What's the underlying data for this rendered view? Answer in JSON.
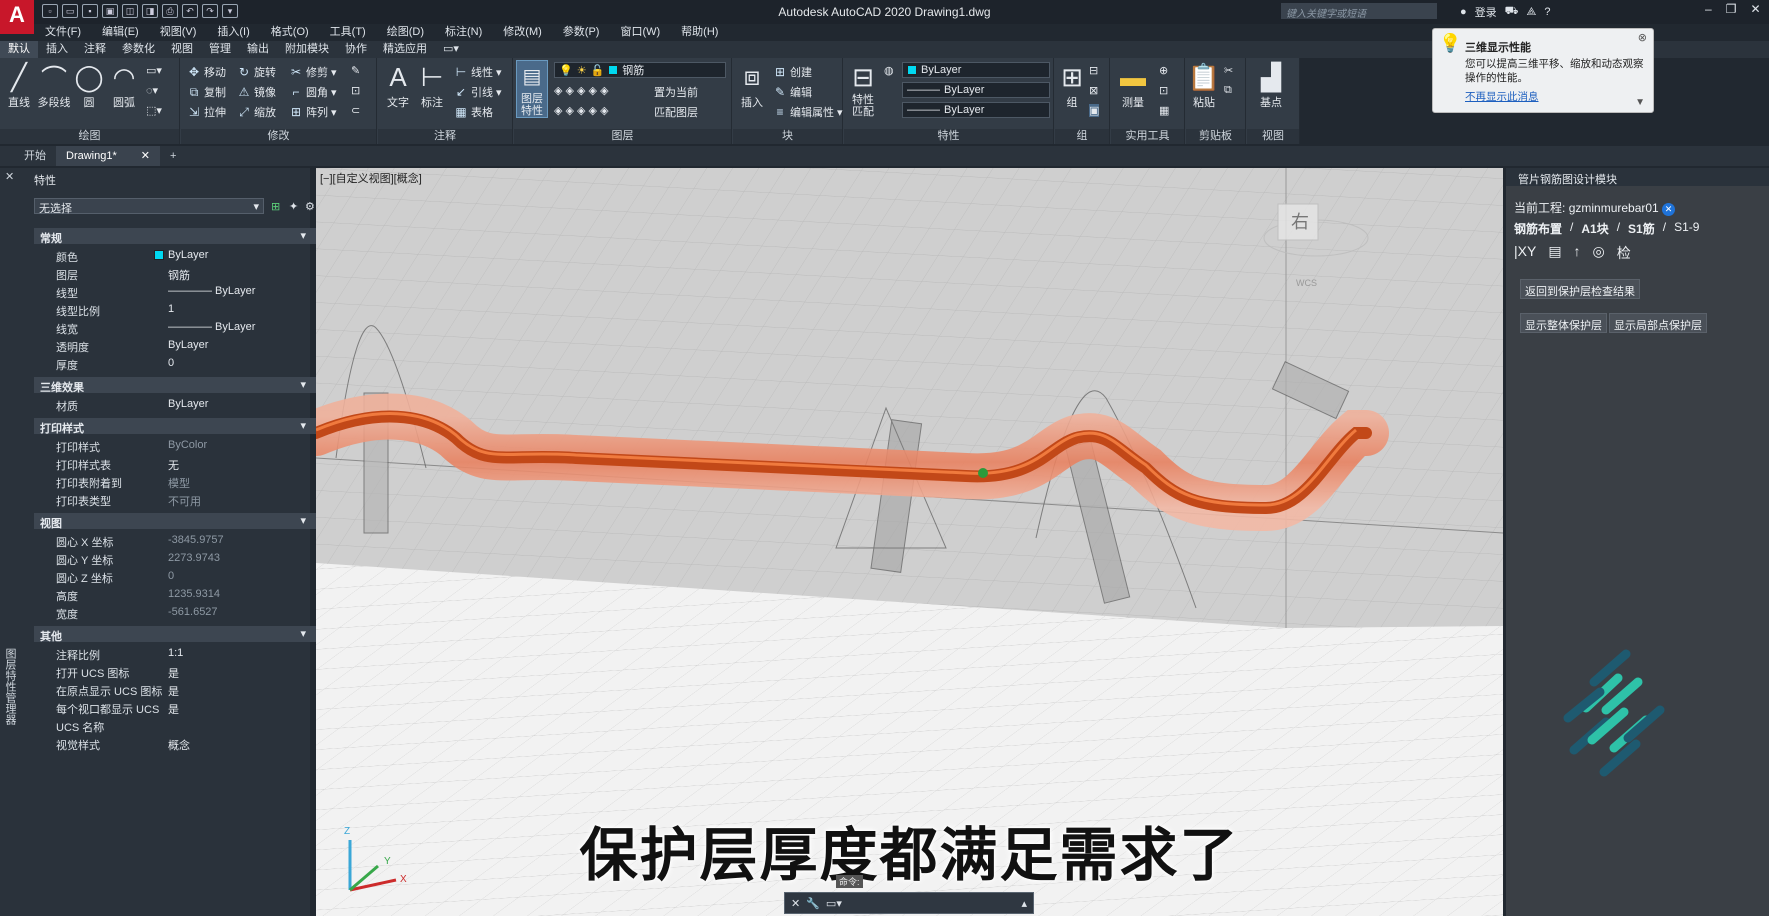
{
  "app": {
    "logo": "A",
    "title": "Autodesk AutoCAD 2020    Drawing1.dwg",
    "search_placeholder": "键入关键字或短语",
    "login": "登录"
  },
  "menus": [
    "文件(F)",
    "编辑(E)",
    "视图(V)",
    "插入(I)",
    "格式(O)",
    "工具(T)",
    "绘图(D)",
    "标注(N)",
    "修改(M)",
    "参数(P)",
    "窗口(W)",
    "帮助(H)"
  ],
  "ribbon_tabs": [
    "默认",
    "插入",
    "注释",
    "参数化",
    "视图",
    "管理",
    "输出",
    "附加模块",
    "协作",
    "精选应用"
  ],
  "ribbon": {
    "draw": {
      "label": "绘图",
      "line": "直线",
      "polyline": "多段线",
      "circle": "圆",
      "arc": "圆弧"
    },
    "modify": {
      "label": "修改",
      "move": "移动",
      "rotate": "旋转",
      "trim": "修剪",
      "copy": "复制",
      "mirror": "镜像",
      "fillet": "圆角",
      "stretch": "拉伸",
      "scale": "缩放",
      "array": "阵列"
    },
    "annotation": {
      "label": "注释",
      "text": "文字",
      "dimension": "标注",
      "linear": "线性",
      "leader": "引线",
      "table": "表格"
    },
    "layers": {
      "label": "图层",
      "layer_props": "图层特性",
      "current_layer": "钢筋",
      "set_current": "置为当前",
      "match_layer": "匹配图层"
    },
    "block": {
      "label": "块",
      "insert": "插入",
      "create": "创建",
      "edit": "编辑",
      "edit_attr": "编辑属性"
    },
    "properties": {
      "label": "特性",
      "match": "特性匹配",
      "color": "ByLayer",
      "linetype": "ByLayer",
      "lineweight": "ByLayer"
    },
    "groups": {
      "label": "组",
      "group": "组"
    },
    "utilities": {
      "label": "实用工具",
      "measure": "测量"
    },
    "clipboard": {
      "label": "剪贴板",
      "paste": "粘贴"
    },
    "view": {
      "label": "视图",
      "base": "基点"
    }
  },
  "tip": {
    "title": "三维显示性能",
    "body": "您可以提高三维平移、缩放和动态观察操作的性能。",
    "link": "不再显示此消息"
  },
  "doc_tabs": [
    "开始",
    "Drawing1*"
  ],
  "left_strip": "图层特性管理器",
  "properties_palette": {
    "header": "特性",
    "selection": "无选择",
    "sections": [
      {
        "title": "常规",
        "rows": [
          [
            "颜色",
            "ByLayer"
          ],
          [
            "图层",
            "钢筋"
          ],
          [
            "线型",
            "———— ByLayer"
          ],
          [
            "线型比例",
            "1"
          ],
          [
            "线宽",
            "———— ByLayer"
          ],
          [
            "透明度",
            "ByLayer"
          ],
          [
            "厚度",
            "0"
          ]
        ]
      },
      {
        "title": "三维效果",
        "rows": [
          [
            "材质",
            "ByLayer"
          ]
        ]
      },
      {
        "title": "打印样式",
        "rows": [
          [
            "打印样式",
            "ByColor"
          ],
          [
            "打印样式表",
            "无"
          ],
          [
            "打印表附着到",
            "模型"
          ],
          [
            "打印表类型",
            "不可用"
          ]
        ]
      },
      {
        "title": "视图",
        "rows": [
          [
            "圆心 X 坐标",
            "-3845.9757"
          ],
          [
            "圆心 Y 坐标",
            "2273.9743"
          ],
          [
            "圆心 Z 坐标",
            "0"
          ],
          [
            "高度",
            "1235.9314"
          ],
          [
            "宽度",
            "-561.6527"
          ]
        ]
      },
      {
        "title": "其他",
        "rows": [
          [
            "注释比例",
            "1:1"
          ],
          [
            "打开 UCS 图标",
            "是"
          ],
          [
            "在原点显示 UCS 图标",
            "是"
          ],
          [
            "每个视口都显示 UCS",
            "是"
          ],
          [
            "UCS 名称",
            ""
          ],
          [
            "视觉样式",
            "概念"
          ]
        ]
      }
    ]
  },
  "viewport": {
    "label": "[−][自定义视图][概念]",
    "subtitle": "保护层厚度都满足需求了",
    "viewcube": "右",
    "ucs_label": "WCS",
    "axis_x": "X",
    "axis_y": "Y",
    "axis_z": "Z"
  },
  "command": {
    "placeholder": "命令:",
    "tooltip": "命令:"
  },
  "right_panel": {
    "header": "管片钢筋图设计模块",
    "project_label": "当前工程:",
    "project": "gzminmurebar01",
    "breadcrumb": [
      "钢筋布置",
      "A1块",
      "S1筋",
      "S1-9"
    ],
    "icons": [
      "|XY",
      "▤",
      "↑",
      "◎",
      "检"
    ],
    "btn_return": "返回到保护层检查结果",
    "btn_global": "显示整体保护层",
    "btn_local": "显示局部点保护层"
  },
  "colors": {
    "accent": "#c8172a",
    "rebar": "#d9551f",
    "cover": "#f0a08a"
  }
}
